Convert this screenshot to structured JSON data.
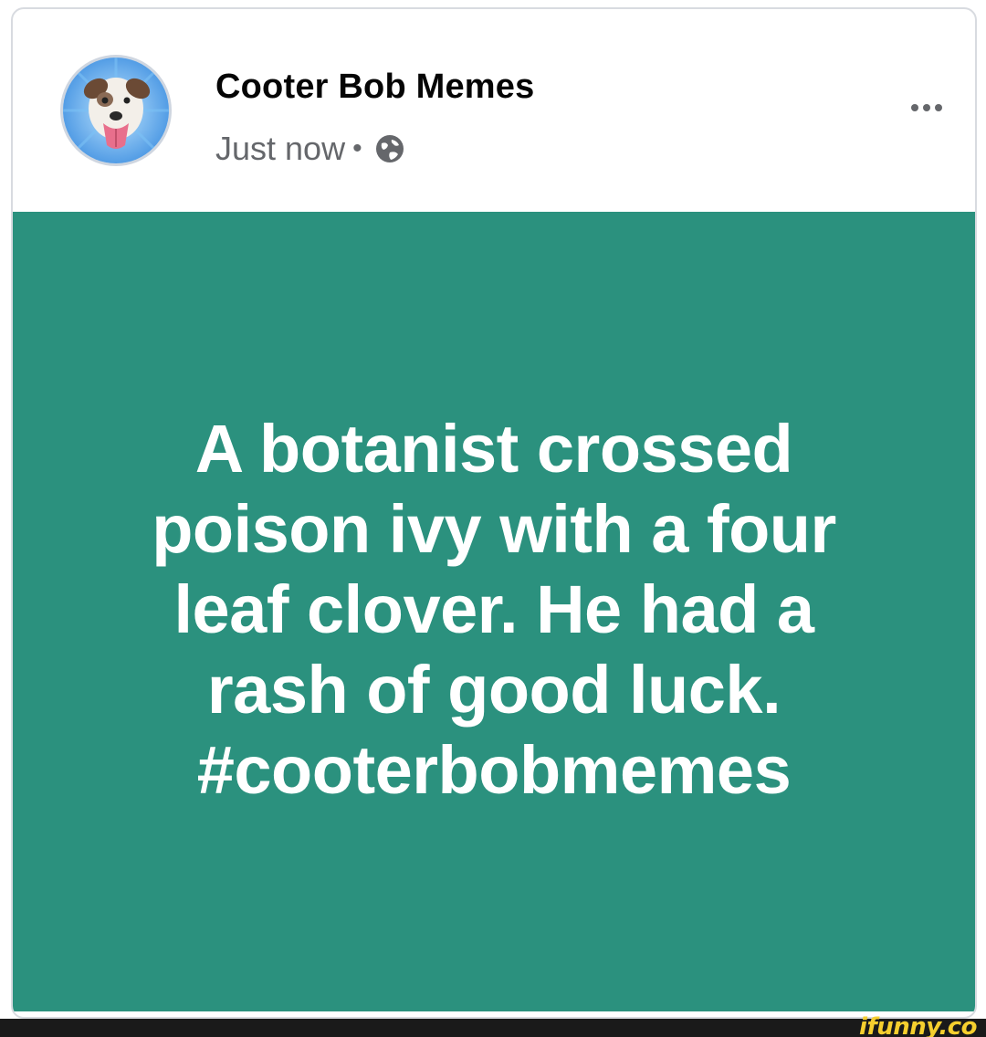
{
  "post": {
    "page_name": "Cooter Bob Memes",
    "timestamp": "Just now",
    "separator": "•",
    "privacy_icon": "globe-icon",
    "more_icon": "ellipsis-icon"
  },
  "image": {
    "background_color": "#2b917e",
    "text_color": "#ffffff",
    "lines": [
      "A botanist crossed",
      "poison ivy with a four",
      "leaf clover. He had a",
      "rash of good luck.",
      "#cooterbobmemes"
    ]
  },
  "watermark": {
    "text": "ifunny.co",
    "color": "#f6cf2e"
  }
}
